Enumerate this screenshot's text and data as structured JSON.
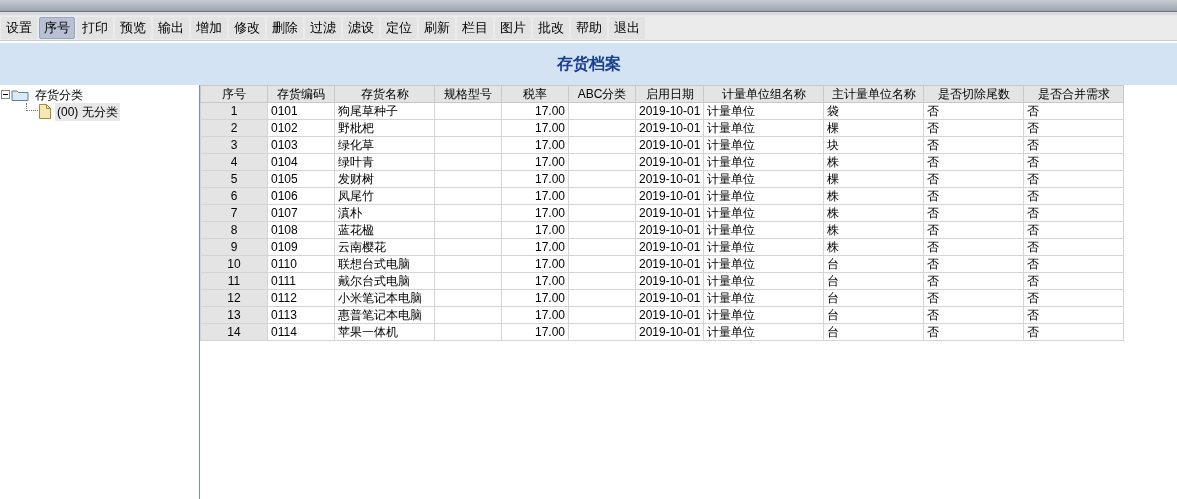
{
  "toolbar": [
    {
      "label": "设置",
      "selected": false
    },
    {
      "label": "序号",
      "selected": true
    },
    {
      "label": "打印",
      "selected": false
    },
    {
      "label": "预览",
      "selected": false
    },
    {
      "label": "输出",
      "selected": false
    },
    {
      "label": "增加",
      "selected": false
    },
    {
      "label": "修改",
      "selected": false
    },
    {
      "label": "删除",
      "selected": false
    },
    {
      "label": "过滤",
      "selected": false
    },
    {
      "label": "滤设",
      "selected": false
    },
    {
      "label": "定位",
      "selected": false
    },
    {
      "label": "刷新",
      "selected": false
    },
    {
      "label": "栏目",
      "selected": false
    },
    {
      "label": "图片",
      "selected": false
    },
    {
      "label": "批改",
      "selected": false
    },
    {
      "label": "帮助",
      "selected": false
    },
    {
      "label": "退出",
      "selected": false
    }
  ],
  "title": "存货档案",
  "tree": [
    {
      "label": "存货分类",
      "expanded": true,
      "children": [
        {
          "label": "(00) 无分类",
          "selected": true
        }
      ]
    }
  ],
  "table": {
    "columns": [
      "序号",
      "存货编码",
      "存货名称",
      "规格型号",
      "税率",
      "ABC分类",
      "启用日期",
      "计量单位组名称",
      "主计量单位名称",
      "是否切除尾数",
      "是否合并需求"
    ],
    "rows": [
      {
        "no": "1",
        "code": "0101",
        "name": "狗尾草种子",
        "tax_rate": "17.00",
        "start_date": "2019-10-01",
        "unit_group": "计量单位",
        "main_unit": "袋",
        "cut_tail": "否",
        "merge_demand": "否"
      },
      {
        "no": "2",
        "code": "0102",
        "name": "野枇杷",
        "tax_rate": "17.00",
        "start_date": "2019-10-01",
        "unit_group": "计量单位",
        "main_unit": "棵",
        "cut_tail": "否",
        "merge_demand": "否"
      },
      {
        "no": "3",
        "code": "0103",
        "name": "绿化草",
        "tax_rate": "17.00",
        "start_date": "2019-10-01",
        "unit_group": "计量单位",
        "main_unit": "块",
        "cut_tail": "否",
        "merge_demand": "否"
      },
      {
        "no": "4",
        "code": "0104",
        "name": "绿叶青",
        "tax_rate": "17.00",
        "start_date": "2019-10-01",
        "unit_group": "计量单位",
        "main_unit": "株",
        "cut_tail": "否",
        "merge_demand": "否"
      },
      {
        "no": "5",
        "code": "0105",
        "name": "发财树",
        "tax_rate": "17.00",
        "start_date": "2019-10-01",
        "unit_group": "计量单位",
        "main_unit": "棵",
        "cut_tail": "否",
        "merge_demand": "否"
      },
      {
        "no": "6",
        "code": "0106",
        "name": "凤尾竹",
        "tax_rate": "17.00",
        "start_date": "2019-10-01",
        "unit_group": "计量单位",
        "main_unit": "株",
        "cut_tail": "否",
        "merge_demand": "否"
      },
      {
        "no": "7",
        "code": "0107",
        "name": "滇朴",
        "tax_rate": "17.00",
        "start_date": "2019-10-01",
        "unit_group": "计量单位",
        "main_unit": "株",
        "cut_tail": "否",
        "merge_demand": "否"
      },
      {
        "no": "8",
        "code": "0108",
        "name": "蓝花楹",
        "tax_rate": "17.00",
        "start_date": "2019-10-01",
        "unit_group": "计量单位",
        "main_unit": "株",
        "cut_tail": "否",
        "merge_demand": "否"
      },
      {
        "no": "9",
        "code": "0109",
        "name": "云南樱花",
        "tax_rate": "17.00",
        "start_date": "2019-10-01",
        "unit_group": "计量单位",
        "main_unit": "株",
        "cut_tail": "否",
        "merge_demand": "否"
      },
      {
        "no": "10",
        "code": "0110",
        "name": "联想台式电脑",
        "tax_rate": "17.00",
        "start_date": "2019-10-01",
        "unit_group": "计量单位",
        "main_unit": "台",
        "cut_tail": "否",
        "merge_demand": "否"
      },
      {
        "no": "11",
        "code": "0111",
        "name": "戴尔台式电脑",
        "tax_rate": "17.00",
        "start_date": "2019-10-01",
        "unit_group": "计量单位",
        "main_unit": "台",
        "cut_tail": "否",
        "merge_demand": "否"
      },
      {
        "no": "12",
        "code": "0112",
        "name": "小米笔记本电脑",
        "tax_rate": "17.00",
        "start_date": "2019-10-01",
        "unit_group": "计量单位",
        "main_unit": "台",
        "cut_tail": "否",
        "merge_demand": "否"
      },
      {
        "no": "13",
        "code": "0113",
        "name": "惠普笔记本电脑",
        "tax_rate": "17.00",
        "start_date": "2019-10-01",
        "unit_group": "计量单位",
        "main_unit": "台",
        "cut_tail": "否",
        "merge_demand": "否"
      },
      {
        "no": "14",
        "code": "0114",
        "name": "苹果一体机",
        "tax_rate": "17.00",
        "start_date": "2019-10-01",
        "unit_group": "计量单位",
        "main_unit": "台",
        "cut_tail": "否",
        "merge_demand": "否"
      }
    ]
  }
}
